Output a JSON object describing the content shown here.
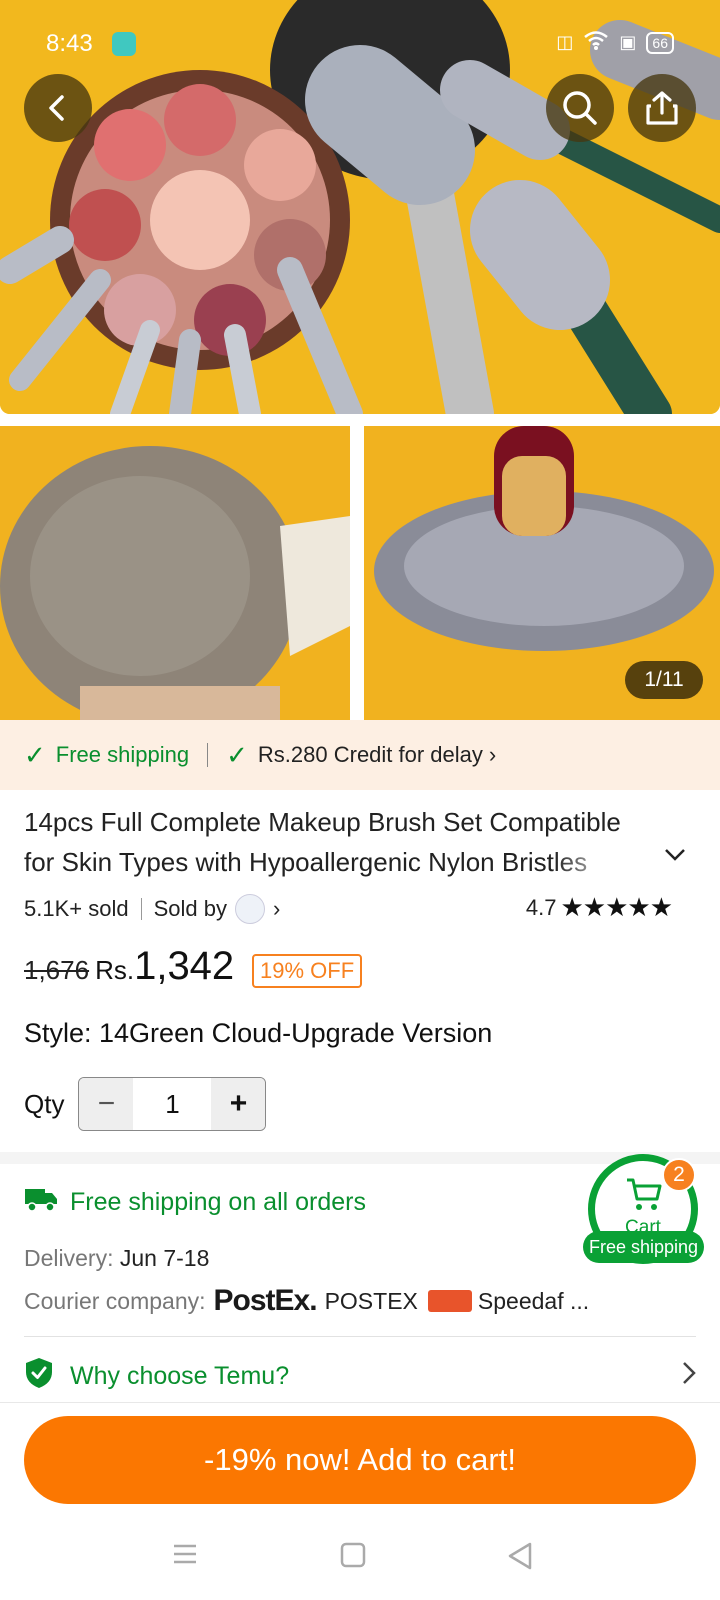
{
  "status_bar": {
    "time": "8:43",
    "battery": "66"
  },
  "gallery": {
    "counter": "1/11"
  },
  "shipping_banner": {
    "free_shipping": "Free shipping",
    "credit": "Rs.280 Credit for delay"
  },
  "product": {
    "title": "14pcs Full Complete Makeup Brush Set Compatible for Skin Types with Hypoallergenic Nylon Bristles",
    "sold": "5.1K+ sold",
    "sold_by_label": "Sold by",
    "rating": "4.7",
    "rating_value": 4.7,
    "rating_max": 5,
    "original_price": "1,676",
    "currency": "Rs.",
    "price": "1,342",
    "discount": "19% OFF",
    "style_label": "Style: 14Green Cloud-Upgrade Version",
    "qty_label": "Qty",
    "qty_value": "1"
  },
  "delivery": {
    "headline": "Free shipping on all orders",
    "delivery_label": "Delivery:",
    "delivery_date": "Jun 7-18",
    "courier_label": "Courier company:",
    "courier_logo": "PostEx.",
    "courier_1": "POSTEX",
    "courier_2": "Speedaf ..."
  },
  "why_temu": {
    "label": "Why choose Temu?"
  },
  "cart": {
    "label": "Cart",
    "badge": "2",
    "shipping_tag": "Free shipping"
  },
  "cta": {
    "label": "-19% now! Add to cart!"
  },
  "colors": {
    "temu_orange": "#fb7701",
    "green": "#0a8f2e",
    "banner_bg": "#fdefe3"
  },
  "icons": [
    "back-icon",
    "search-icon",
    "share-icon",
    "check-icon",
    "chevron-right-icon",
    "chevron-down-icon",
    "star-icon",
    "minus-icon",
    "plus-icon",
    "truck-icon",
    "shield-check-icon",
    "cart-icon",
    "menu-icon",
    "home-icon",
    "back-triangle-icon"
  ]
}
